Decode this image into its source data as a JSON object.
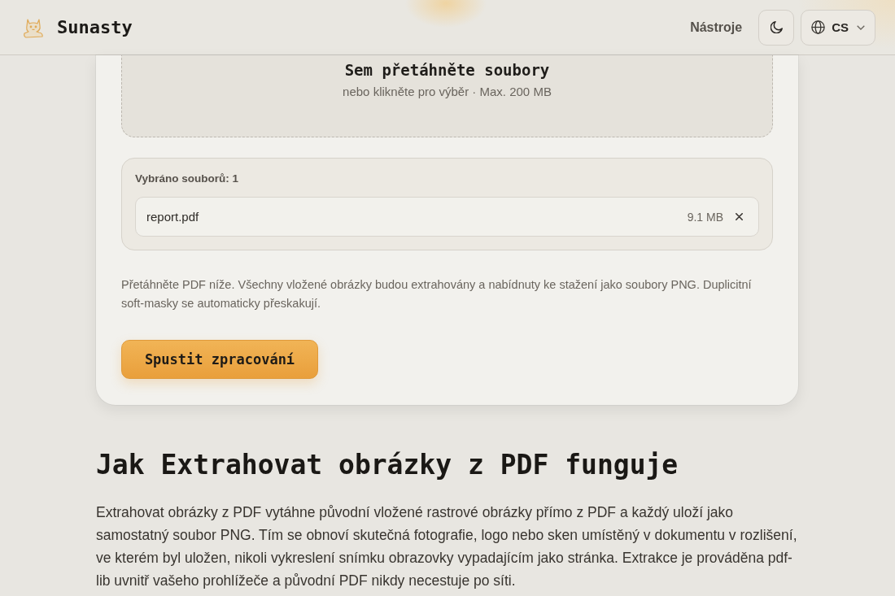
{
  "header": {
    "brand": "Sunasty",
    "nav_link": "Nástroje",
    "language": "CS"
  },
  "upload": {
    "dropzone": {
      "title": "Sem přetáhněte soubory",
      "subtitle": "nebo klikněte pro výběr · Max. 200 MB"
    },
    "selected_files": {
      "label": "Vybráno souborů: 1",
      "files": [
        {
          "name": "report.pdf",
          "size": "9.1 MB"
        }
      ]
    },
    "description": "Přetáhněte PDF níže. Všechny vložené obrázky budou extrahovány a nabídnuty ke stažení jako soubory PNG. Duplicitní soft-masky se automaticky přeskakují.",
    "button": "Spustit zpracování"
  },
  "article": {
    "heading": "Jak Extrahovat obrázky z PDF funguje",
    "paragraph": "Extrahovat obrázky z PDF vytáhne původní vložené rastrové obrázky přímo z PDF a každý uloží jako samostatný soubor PNG. Tím se obnoví skutečná fotografie, logo nebo sken umístěný v dokumentu v rozlišení, ve kterém byl uložen, nikoli vykreslení snímku obrazovky vypadajícím jako stránka. Extrakce je prováděna pdf-lib uvnitř vašeho prohlížeče a původní PDF nikdy necestuje po síti."
  }
}
